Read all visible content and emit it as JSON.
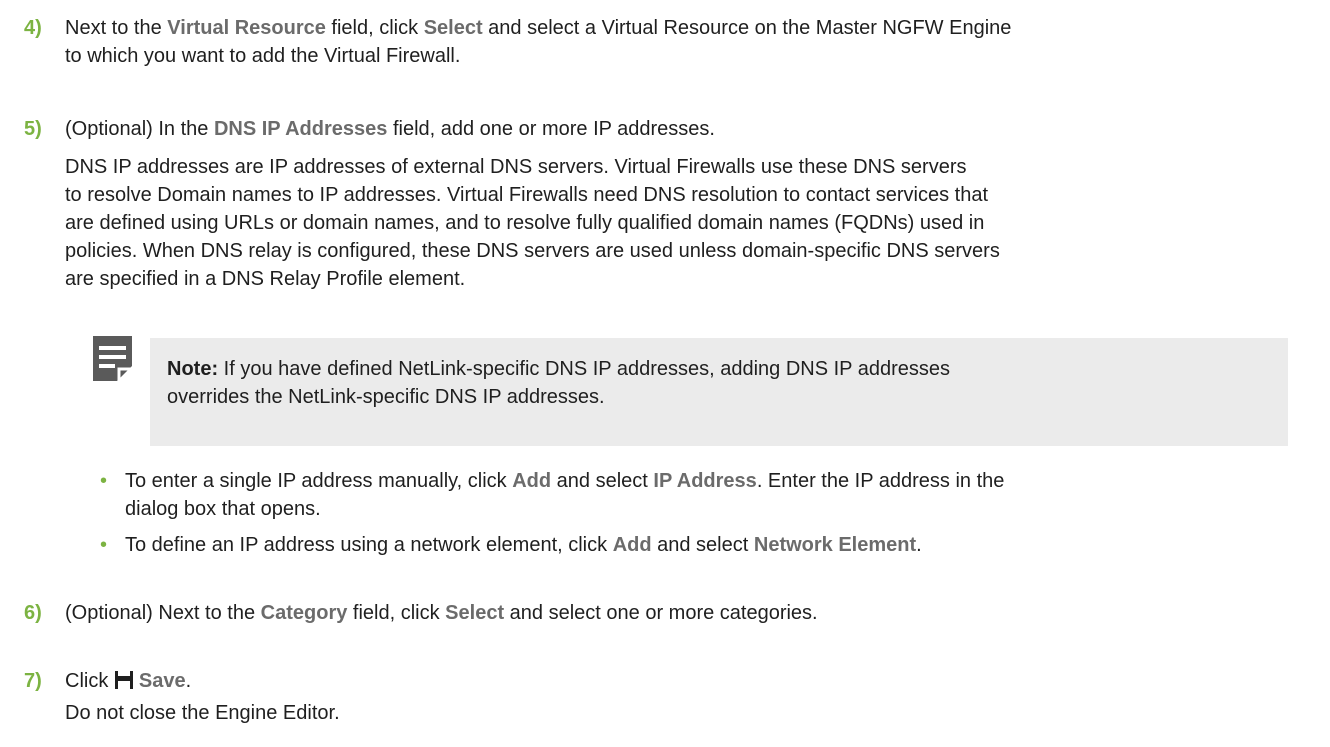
{
  "step4": {
    "num": "4)",
    "t1": "Next to the ",
    "u1": "Virtual Resource",
    "t2": " field, click ",
    "u2": "Select",
    "t3": " and select a Virtual Resource on the Master NGFW Engine",
    "line2": "to which you want to add the Virtual Firewall."
  },
  "step5": {
    "num": "5)",
    "t1": "(Optional) In the ",
    "u1": "DNS IP Addresses",
    "t2": " field, add one or more IP addresses.",
    "para": [
      "DNS IP addresses are IP addresses of external DNS servers. Virtual Firewalls use these DNS servers",
      "to resolve Domain names to IP addresses. Virtual Firewalls need DNS resolution to contact services that",
      "are defined using URLs or domain names, and to resolve fully qualified domain names (FQDNs) used in",
      "policies. When DNS relay is configured, these DNS servers are used unless domain-specific DNS servers",
      "are specified in a DNS Relay Profile element."
    ],
    "note": {
      "icon": "note-icon",
      "label": "Note:",
      "line1": " If you have defined NetLink-specific DNS IP addresses, adding DNS IP addresses",
      "line2": "overrides the NetLink-specific DNS IP addresses."
    },
    "bullets": {
      "marker": "•",
      "b1": {
        "t1": "To enter a single IP address manually, click ",
        "u1": "Add",
        "t2": " and select ",
        "u2": "IP Address",
        "t3": ". Enter the IP address in the",
        "line2": "dialog box that opens."
      },
      "b2": {
        "t1": "To define an IP address using a network element, click ",
        "u1": "Add",
        "t2": " and select ",
        "u2": "Network Element",
        "t3": "."
      }
    }
  },
  "step6": {
    "num": "6)",
    "t1": "(Optional) Next to the ",
    "u1": "Category",
    "t2": " field, click ",
    "u2": "Select",
    "t3": " and select one or more categories."
  },
  "step7": {
    "num": "7)",
    "t1": "Click ",
    "icon": "save-icon",
    "u1": "Save",
    "t2": ".",
    "line2": "Do not close the Engine Editor."
  }
}
